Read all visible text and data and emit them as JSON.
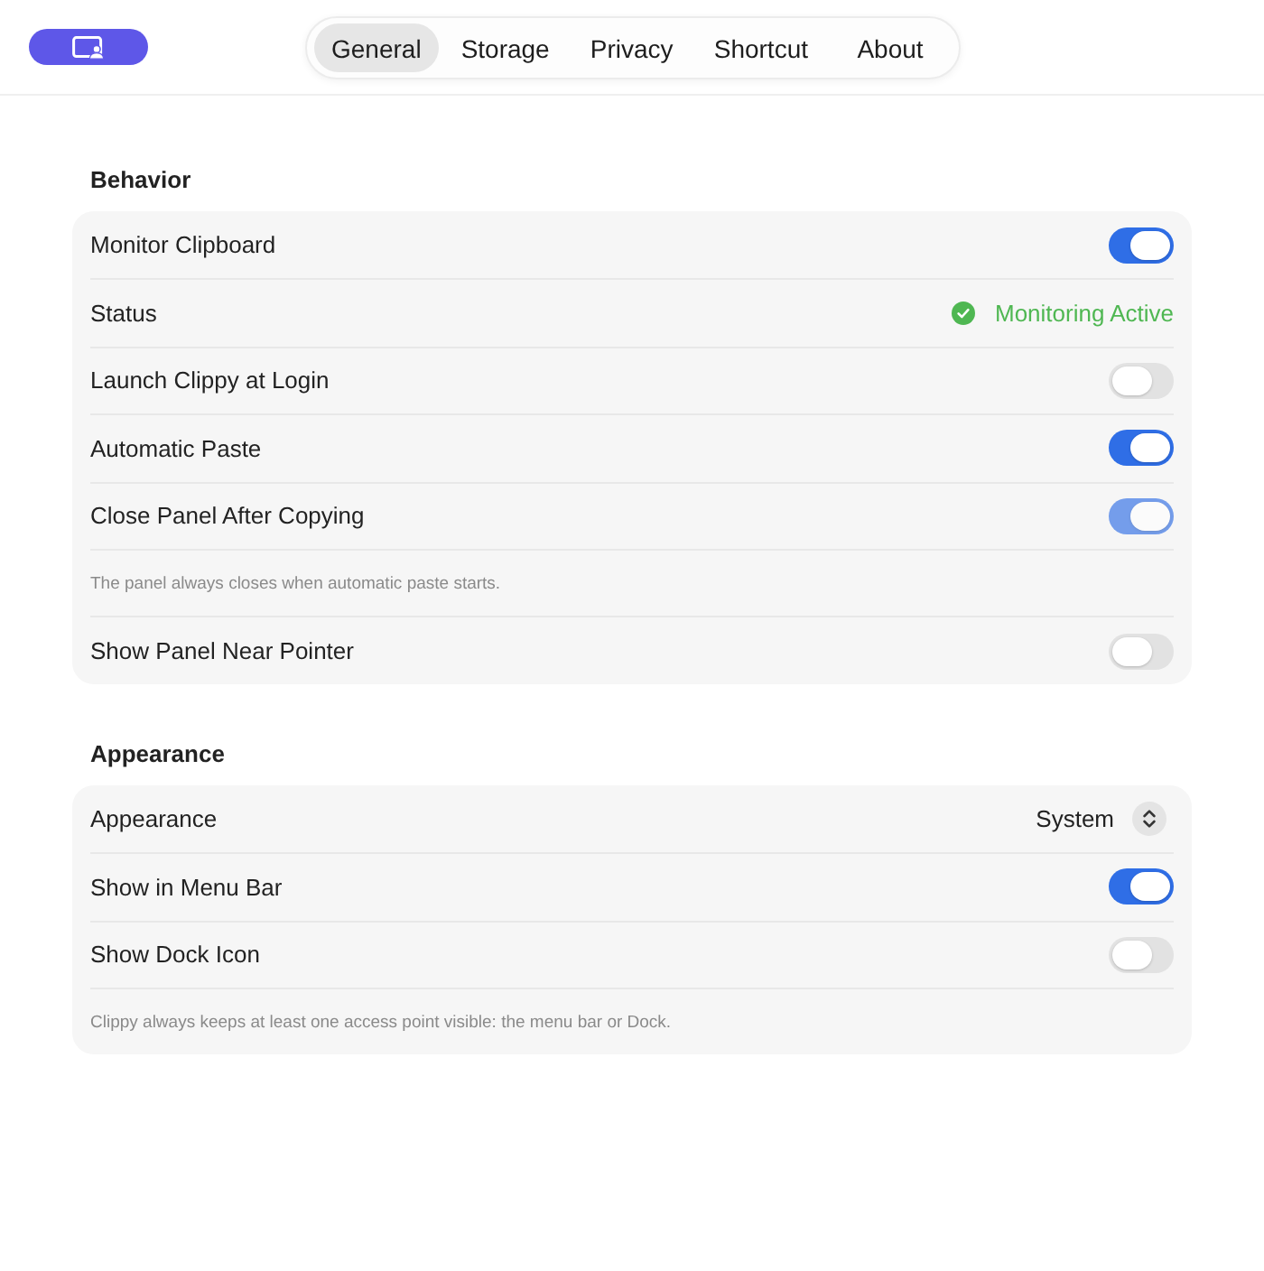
{
  "tabs": [
    {
      "label": "General",
      "selected": true
    },
    {
      "label": "Storage",
      "selected": false
    },
    {
      "label": "Privacy",
      "selected": false
    },
    {
      "label": "Shortcut",
      "selected": false
    },
    {
      "label": "About",
      "selected": false
    }
  ],
  "sections": [
    {
      "title": "Behavior",
      "rows": [
        {
          "kind": "toggle",
          "label": "Monitor Clipboard",
          "on": true,
          "disabled": false
        },
        {
          "kind": "status",
          "label": "Status",
          "value": "Monitoring Active"
        },
        {
          "kind": "toggle",
          "label": "Launch Clippy at Login",
          "on": false,
          "disabled": false
        },
        {
          "kind": "toggle",
          "label": "Automatic Paste",
          "on": true,
          "disabled": false
        },
        {
          "kind": "toggle",
          "label": "Close Panel After Copying",
          "on": true,
          "disabled": true
        },
        {
          "kind": "note",
          "text": "The panel always closes when automatic paste starts."
        },
        {
          "kind": "toggle",
          "label": "Show Panel Near Pointer",
          "on": false,
          "disabled": false
        }
      ]
    },
    {
      "title": "Appearance",
      "rows": [
        {
          "kind": "select",
          "label": "Appearance",
          "value": "System"
        },
        {
          "kind": "toggle",
          "label": "Show in Menu Bar",
          "on": true,
          "disabled": false
        },
        {
          "kind": "toggle",
          "label": "Show Dock Icon",
          "on": false,
          "disabled": false
        },
        {
          "kind": "note",
          "text": "Clippy always keeps at least one access point visible: the menu bar or Dock."
        }
      ]
    }
  ]
}
